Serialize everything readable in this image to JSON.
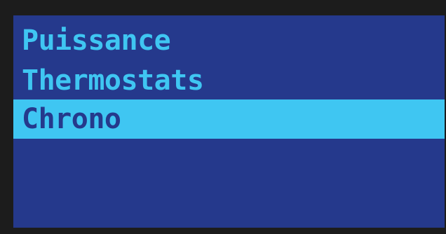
{
  "display": {
    "background_color": "#25398c",
    "text_color": "#3fc6f2",
    "highlight_color": "#3fc6f2",
    "highlight_text_color": "#25398c"
  },
  "menu": {
    "selected_index": 2,
    "items": [
      {
        "label": "Puissance"
      },
      {
        "label": "Thermostats"
      },
      {
        "label": "Chrono"
      }
    ]
  }
}
